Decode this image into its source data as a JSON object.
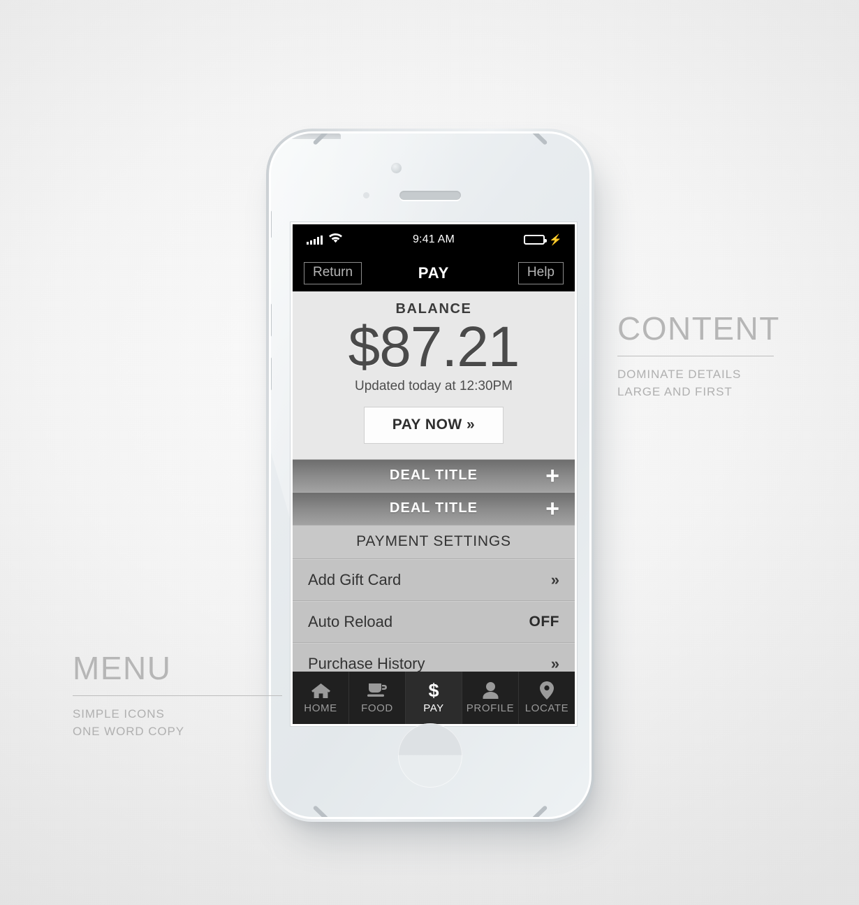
{
  "phone": {
    "device_name": "smartphone-mockup"
  },
  "status_bar": {
    "time": "9:41 AM",
    "signal_icon": "signal-bars-icon",
    "wifi_icon": "wifi-icon",
    "battery_icon": "battery-icon",
    "charging_icon": "lightning-bolt-icon"
  },
  "nav_bar": {
    "back_label": "Return",
    "title": "PAY",
    "help_label": "Help"
  },
  "balance": {
    "label": "BALANCE",
    "amount": "$87.21",
    "updated": "Updated today at 12:30PM",
    "pay_now_label": "PAY NOW »"
  },
  "deals": [
    {
      "title": "DEAL TITLE",
      "expand_icon": "+"
    },
    {
      "title": "DEAL TITLE",
      "expand_icon": "+"
    }
  ],
  "settings": {
    "section_title": "PAYMENT SETTINGS",
    "rows": [
      {
        "label": "Add Gift Card",
        "value": "",
        "chevron": "»"
      },
      {
        "label": "Auto Reload",
        "value": "OFF",
        "chevron": ""
      },
      {
        "label": "Purchase History",
        "value": "",
        "chevron": "»"
      }
    ]
  },
  "tab_bar": {
    "tabs": [
      {
        "label": "HOME",
        "icon": "home-icon",
        "active": false
      },
      {
        "label": "FOOD",
        "icon": "coffee-cup-icon",
        "active": false
      },
      {
        "label": "PAY",
        "icon": "dollar-icon",
        "active": true
      },
      {
        "label": "PROFILE",
        "icon": "person-icon",
        "active": false
      },
      {
        "label": "LOCATE",
        "icon": "map-pin-icon",
        "active": false
      }
    ]
  },
  "annotations": {
    "content": {
      "title": "CONTENT",
      "line1": "DOMINATE DETAILS",
      "line2": "LARGE AND FIRST"
    },
    "menu": {
      "title": "MENU",
      "line1": "SIMPLE ICONS",
      "line2": "ONE WORD COPY"
    }
  },
  "colors": {
    "screen_dark": "#000000",
    "tab_bar_bg": "#191919",
    "balance_bg": "#e8e8e8",
    "list_bg": "#c3c3c3",
    "annotation_text": "#b6b6b6"
  }
}
